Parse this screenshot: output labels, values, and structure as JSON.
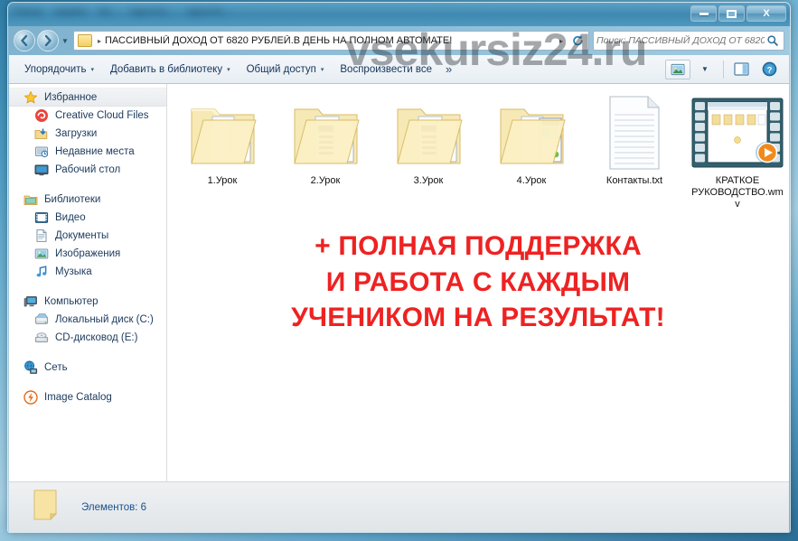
{
  "watermark": "vsekursiz24.ru",
  "titlebar": {
    "blurred_fragments": [
      "Папка",
      "сервис",
      "по...",
      "курсите...",
      "курсите..."
    ],
    "minimize_label": "—",
    "maximize_label": "□",
    "close_label": "X"
  },
  "address": {
    "path": "ПАССИВНЫЙ ДОХОД ОТ 6820 РУБЛЕЙ.В ДЕНЬ НА ПОЛНОМ АВТОМАТЕ!",
    "separator": "▸",
    "back_tooltip": "Назад",
    "forward_tooltip": "Вперед"
  },
  "search": {
    "placeholder": "Поиск: ПАССИВНЫЙ ДОХОД ОТ 6820 Р...",
    "value": ""
  },
  "toolbar": {
    "organize": "Упорядочить",
    "add_to_library": "Добавить в библиотеку",
    "share": "Общий доступ",
    "play_all": "Воспроизвести все",
    "overflow": "»",
    "caret": "▾"
  },
  "sidebar": {
    "groups": [
      {
        "header": "Избранное",
        "icon": "star-icon",
        "items": [
          {
            "label": "Creative Cloud Files",
            "icon": "creative-cloud-icon"
          },
          {
            "label": "Загрузки",
            "icon": "downloads-icon"
          },
          {
            "label": "Недавние места",
            "icon": "recent-places-icon"
          },
          {
            "label": "Рабочий стол",
            "icon": "desktop-icon"
          }
        ]
      },
      {
        "header": "Библиотеки",
        "icon": "libraries-icon",
        "items": [
          {
            "label": "Видео",
            "icon": "video-icon"
          },
          {
            "label": "Документы",
            "icon": "documents-icon"
          },
          {
            "label": "Изображения",
            "icon": "pictures-icon"
          },
          {
            "label": "Музыка",
            "icon": "music-icon"
          }
        ]
      },
      {
        "header": "Компьютер",
        "icon": "computer-icon",
        "items": [
          {
            "label": "Локальный диск (C:)",
            "icon": "hard-drive-icon"
          },
          {
            "label": "CD-дисковод (E:)",
            "icon": "cd-drive-icon"
          }
        ]
      },
      {
        "header": "Сеть",
        "icon": "network-icon",
        "items": []
      },
      {
        "header": "Image Catalog",
        "icon": "image-catalog-icon",
        "items": []
      }
    ]
  },
  "files": [
    {
      "name": "1.Урок",
      "type": "folder",
      "thumb": "folder-thumb-document"
    },
    {
      "name": "2.Урок",
      "type": "folder",
      "thumb": "folder-thumb-webpage"
    },
    {
      "name": "3.Урок",
      "type": "folder",
      "thumb": "folder-thumb-webpage"
    },
    {
      "name": "4.Урок",
      "type": "folder",
      "thumb": "folder-thumb-browser"
    },
    {
      "name": "Контакты.txt",
      "type": "text-file",
      "thumb": "text-document-icon"
    },
    {
      "name": "КРАТКОЕ РУКОВОДСТВО.wmv",
      "type": "video-file",
      "thumb": "video-filmstrip-icon"
    }
  ],
  "promo": {
    "line1": "+ ПОЛНАЯ ПОДДЕРЖКА",
    "line2": "И РАБОТА С КАЖДЫМ",
    "line3": "УЧЕНИКОМ НА РЕЗУЛЬТАТ!",
    "color": "#ee2222"
  },
  "status": {
    "items_count_label": "Элементов: 6",
    "color": "#17508c"
  },
  "colors": {
    "titlebar": "#3f89b2",
    "toolbar": "#eef2f6",
    "sidebar_text": "#1b3a5c",
    "accent_red": "#ee2222",
    "status_blue": "#17508c"
  }
}
